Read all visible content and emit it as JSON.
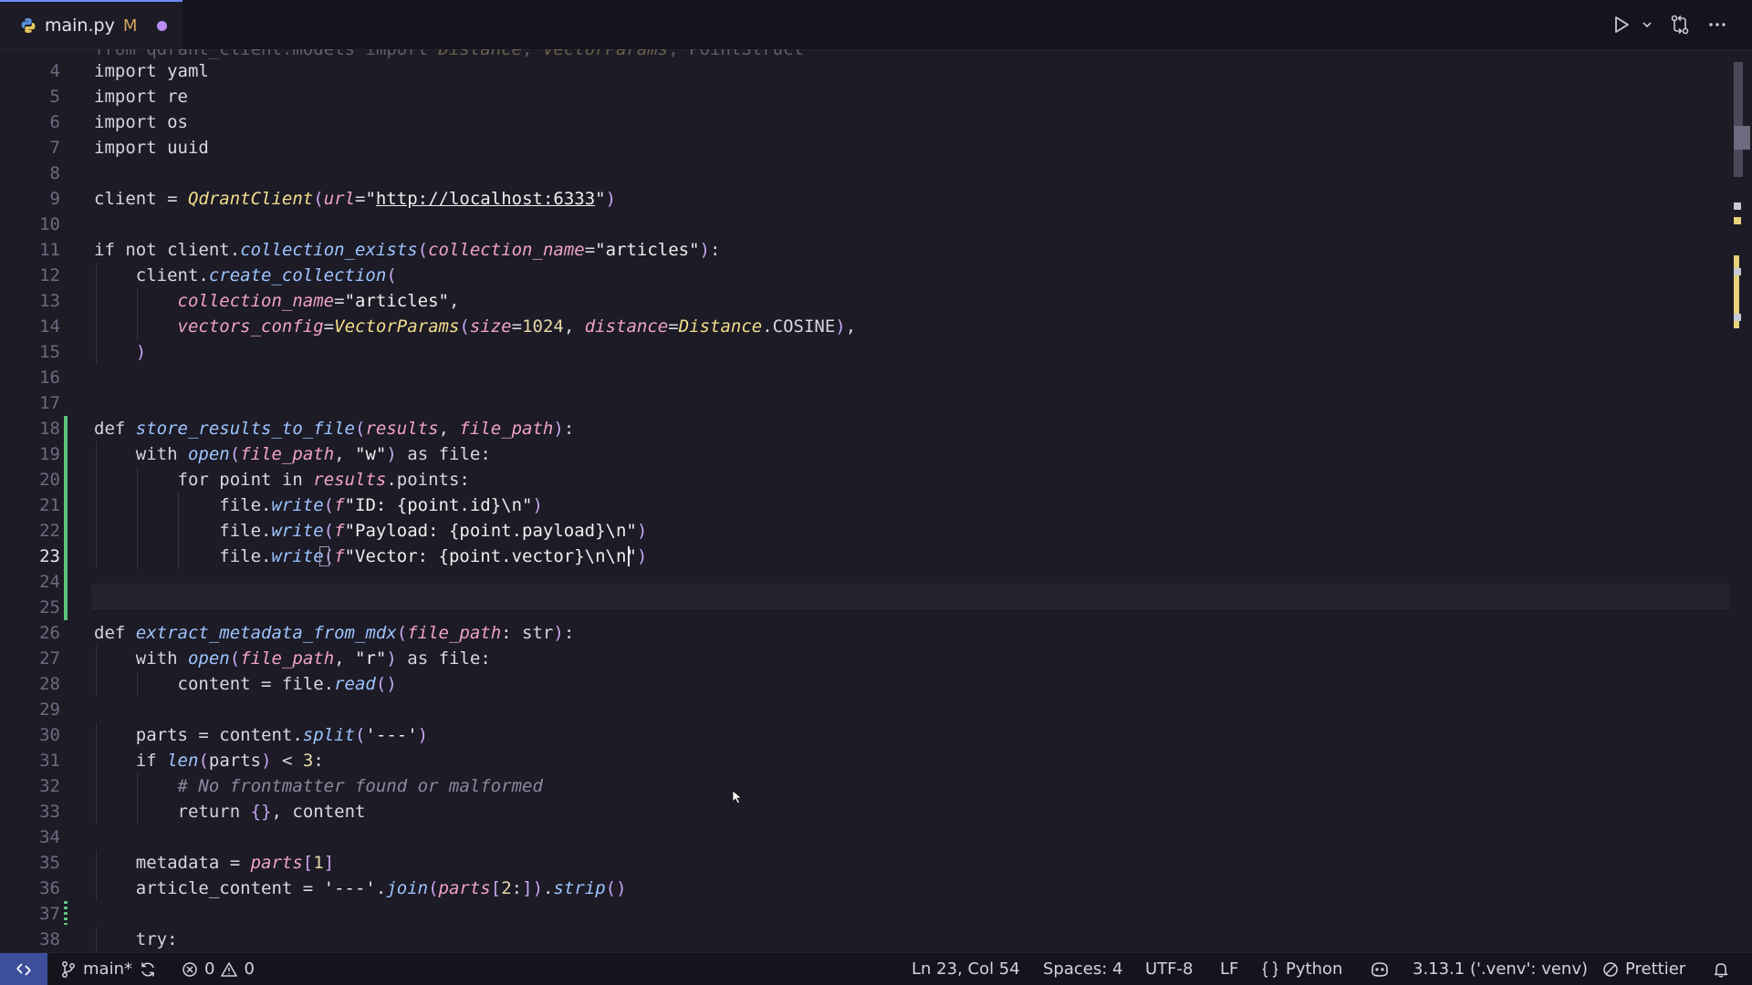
{
  "tab": {
    "filename": "main.py",
    "status": "M"
  },
  "editor": {
    "partial_line": "from qdrant_client.models import Distance, VectorParams, PointStruct",
    "lines": [
      {
        "n": "4",
        "t": "import yaml"
      },
      {
        "n": "5",
        "t": "import re"
      },
      {
        "n": "6",
        "t": "import os"
      },
      {
        "n": "7",
        "t": "import uuid"
      },
      {
        "n": "8",
        "t": ""
      },
      {
        "n": "9",
        "t": "client = QdrantClient(url=\"http://localhost:6333\")"
      },
      {
        "n": "10",
        "t": ""
      },
      {
        "n": "11",
        "t": "if not client.collection_exists(collection_name=\"articles\"):"
      },
      {
        "n": "12",
        "t": "    client.create_collection("
      },
      {
        "n": "13",
        "t": "        collection_name=\"articles\","
      },
      {
        "n": "14",
        "t": "        vectors_config=VectorParams(size=1024, distance=Distance.COSINE),"
      },
      {
        "n": "15",
        "t": "    )"
      },
      {
        "n": "16",
        "t": ""
      },
      {
        "n": "17",
        "t": ""
      },
      {
        "n": "18",
        "t": "def store_results_to_file(results, file_path):"
      },
      {
        "n": "19",
        "t": "    with open(file_path, \"w\") as file:"
      },
      {
        "n": "20",
        "t": "        for point in results.points:"
      },
      {
        "n": "21",
        "t": "            file.write(f\"ID: {point.id}\\n\")"
      },
      {
        "n": "22",
        "t": "            file.write(f\"Payload: {point.payload}\\n\")"
      },
      {
        "n": "23",
        "t": "            file.write(f\"Vector: {point.vector}\\n\\n\")"
      },
      {
        "n": "24",
        "t": ""
      },
      {
        "n": "25",
        "t": ""
      },
      {
        "n": "26",
        "t": "def extract_metadata_from_mdx(file_path: str):"
      },
      {
        "n": "27",
        "t": "    with open(file_path, \"r\") as file:"
      },
      {
        "n": "28",
        "t": "        content = file.read()"
      },
      {
        "n": "29",
        "t": ""
      },
      {
        "n": "30",
        "t": "    parts = content.split('---')"
      },
      {
        "n": "31",
        "t": "    if len(parts) < 3:"
      },
      {
        "n": "32",
        "t": "        # No frontmatter found or malformed"
      },
      {
        "n": "33",
        "t": "        return {}, content"
      },
      {
        "n": "34",
        "t": ""
      },
      {
        "n": "35",
        "t": "    metadata = parts[1]"
      },
      {
        "n": "36",
        "t": "    article_content = '---'.join(parts[2:]).strip()"
      },
      {
        "n": "37",
        "t": ""
      },
      {
        "n": "38",
        "t": "    try:"
      }
    ],
    "active_line": "23"
  },
  "statusbar": {
    "branch": "main*",
    "errors": "0",
    "warnings": "0",
    "cursor_position": "Ln 23, Col 54",
    "indentation": "Spaces: 4",
    "encoding": "UTF-8",
    "line_ending": "LF",
    "language": "Python",
    "interpreter": "3.13.1 ('.venv': venv)",
    "formatter": "Prettier"
  },
  "icons": {
    "tab": [
      "python-file-icon",
      "dirty-indicator-icon"
    ],
    "actions": [
      "run-icon",
      "chevron-down-icon",
      "git-compare-icon",
      "more-actions-icon"
    ],
    "status": [
      "remote-icon",
      "git-branch-icon",
      "sync-icon",
      "error-icon",
      "warning-icon",
      "braces-icon",
      "copilot-icon",
      "no-formatter-icon",
      "bell-icon"
    ]
  },
  "colors": {
    "background": "#1c1b26",
    "keyword": "#d3d3e3",
    "function": "#9ec4ff",
    "class": "#f4df8c",
    "parameter": "#f0a2c8",
    "added_diff": "#5fc47c",
    "modified_tab": "#d6a45c",
    "remote_button": "#3d4f9a"
  }
}
